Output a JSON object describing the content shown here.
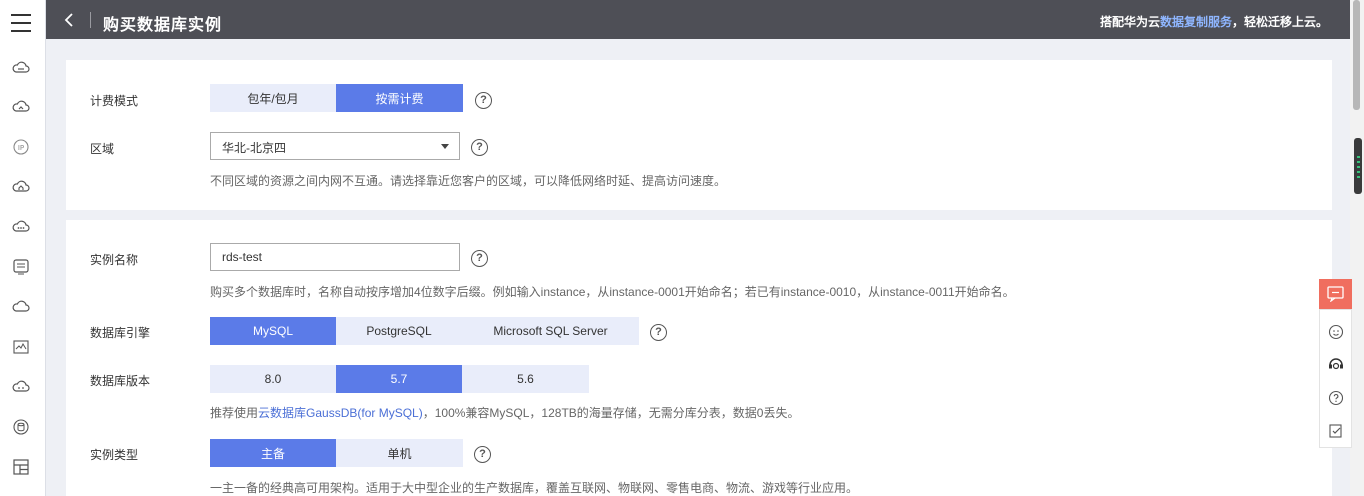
{
  "header": {
    "title": "购买数据库实例",
    "promo_prefix": "搭配华为云",
    "promo_link": "数据复制服务",
    "promo_suffix": "，轻松迁移上云。"
  },
  "rail_icons": [
    "cloud-icon",
    "cloud-refresh-icon",
    "ip-icon",
    "cloud-home-icon",
    "cloud-dots-icon",
    "list-panel-icon",
    "cloud-outline-icon",
    "monitor-chart-icon",
    "cloud-more-icon",
    "database-icon",
    "layout-icon"
  ],
  "billing": {
    "label": "计费模式",
    "options": [
      "包年/包月",
      "按需计费"
    ],
    "selected": "按需计费"
  },
  "region": {
    "label": "区域",
    "value": "华北-北京四",
    "hint": "不同区域的资源之间内网不互通。请选择靠近您客户的区域，可以降低网络时延、提高访问速度。"
  },
  "instance_name": {
    "label": "实例名称",
    "value": "rds-test",
    "hint": "购买多个数据库时，名称自动按序增加4位数字后缀。例如输入instance，从instance-0001开始命名；若已有instance-0010，从instance-0011开始命名。"
  },
  "engine": {
    "label": "数据库引擎",
    "options": [
      "MySQL",
      "PostgreSQL",
      "Microsoft SQL Server"
    ],
    "selected": "MySQL"
  },
  "version": {
    "label": "数据库版本",
    "options": [
      "8.0",
      "5.7",
      "5.6"
    ],
    "selected": "5.7",
    "hint_prefix": "推荐使用",
    "hint_link": "云数据库GaussDB(for MySQL)",
    "hint_suffix": "，100%兼容MySQL，128TB的海量存储，无需分库分表，数据0丢失。"
  },
  "instance_type": {
    "label": "实例类型",
    "options": [
      "主备",
      "单机"
    ],
    "selected": "主备",
    "hint": "一主一备的经典高可用架构。适用于大中型企业的生产数据库，覆盖互联网、物联网、零售电商、物流、游戏等行业应用。"
  },
  "help_glyph": "?",
  "colors": {
    "header_bg": "#4e4f56",
    "accent": "#5b7be8",
    "segment_bg": "#e9edfa",
    "link": "#4b6fd6",
    "float_accent": "#f06e5f"
  }
}
